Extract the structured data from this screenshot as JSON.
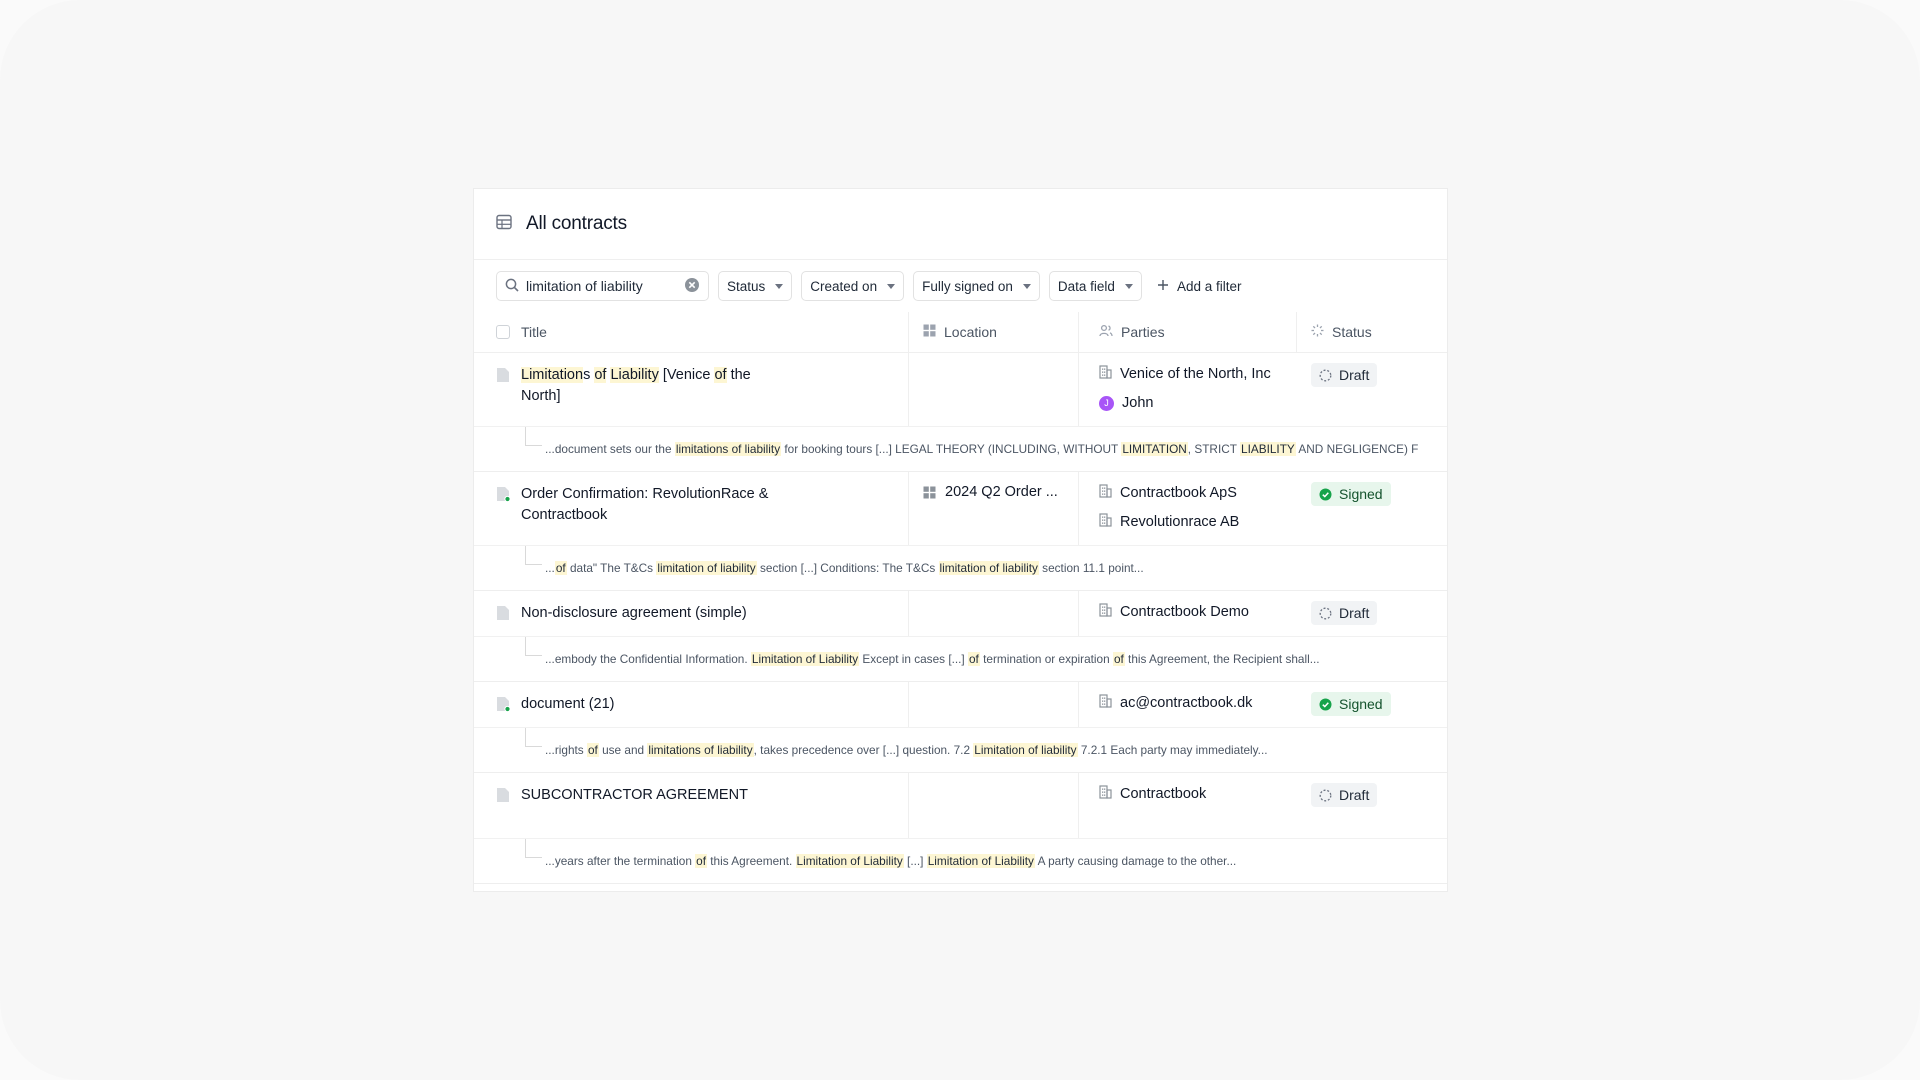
{
  "header": {
    "title": "All contracts",
    "icon": "table-icon"
  },
  "toolbar": {
    "search_value": "limitation of liability",
    "filters": [
      "Status",
      "Created on",
      "Fully signed on",
      "Data field"
    ],
    "add_filter_label": "Add a filter"
  },
  "columns": {
    "title": "Title",
    "location": "Location",
    "parties": "Parties",
    "status": "Status"
  },
  "rows": [
    {
      "title_parts": [
        [
          "Limitation",
          true
        ],
        [
          "s ",
          false
        ],
        [
          "of",
          true
        ],
        [
          " ",
          false
        ],
        [
          "Liability",
          true
        ],
        [
          " [Venice ",
          false
        ],
        [
          "of",
          true
        ],
        [
          " the North]",
          false
        ]
      ],
      "location": "",
      "parties": [
        {
          "name": "Venice of the North, Inc",
          "icon": "building-icon"
        },
        {
          "name": "John",
          "icon": "avatar",
          "initial": "J"
        }
      ],
      "status": "Draft",
      "signed_dot": false,
      "snippet_parts": [
        [
          "...document sets our the ",
          false
        ],
        [
          "limitations of liability",
          true
        ],
        [
          " for booking tours [...] LEGAL THEORY (INCLUDING, WITHOUT ",
          false
        ],
        [
          "LIMITATION",
          true
        ],
        [
          ", STRICT ",
          false
        ],
        [
          "LIABILITY",
          true
        ],
        [
          " AND NEGLIGENCE) F",
          false
        ]
      ]
    },
    {
      "title_parts": [
        [
          "Order Confirmation: RevolutionRace & Contractbook",
          false
        ]
      ],
      "location": "2024 Q2 Order ...",
      "parties": [
        {
          "name": "Contractbook ApS",
          "icon": "building-icon"
        },
        {
          "name": "Revolutionrace AB",
          "icon": "building-icon"
        }
      ],
      "status": "Signed",
      "signed_dot": true,
      "snippet_parts": [
        [
          "...",
          false
        ],
        [
          "of",
          true
        ],
        [
          " data\" The T&Cs ",
          false
        ],
        [
          "limitation of liability",
          true
        ],
        [
          " section [...] Conditions: The T&Cs ",
          false
        ],
        [
          "limitation of liability",
          true
        ],
        [
          " section 11.1 point...",
          false
        ]
      ]
    },
    {
      "title_parts": [
        [
          "Non-disclosure agreement (simple)",
          false
        ]
      ],
      "location": "",
      "parties": [
        {
          "name": "Contractbook Demo",
          "icon": "building-icon"
        }
      ],
      "status": "Draft",
      "signed_dot": false,
      "snippet_parts": [
        [
          "...embody the Confidential Information. ",
          false
        ],
        [
          "Limitation of Liability",
          true
        ],
        [
          " Except in cases [...] ",
          false
        ],
        [
          "of",
          true
        ],
        [
          " termination or expiration ",
          false
        ],
        [
          "of",
          true
        ],
        [
          " this Agreement, the Recipient shall...",
          false
        ]
      ]
    },
    {
      "title_parts": [
        [
          "document (21)",
          false
        ]
      ],
      "location": "",
      "parties": [
        {
          "name": "ac@contractbook.dk",
          "icon": "building-icon"
        }
      ],
      "status": "Signed",
      "signed_dot": true,
      "snippet_parts": [
        [
          "...rights ",
          false
        ],
        [
          "of",
          true
        ],
        [
          " use and ",
          false
        ],
        [
          "limitations of liability",
          true
        ],
        [
          ", takes precedence over [...] question. 7.2 ",
          false
        ],
        [
          "Limitation of liability",
          true
        ],
        [
          " 7.2.1 Each party may immediately...",
          false
        ]
      ]
    },
    {
      "title_parts": [
        [
          "SUBCONTRACTOR AGREEMENT",
          false
        ]
      ],
      "location": "",
      "parties": [
        {
          "name": "Contractbook",
          "icon": "building-icon"
        }
      ],
      "status": "Draft",
      "signed_dot": false,
      "snippet_parts": [
        [
          "...years after the termination ",
          false
        ],
        [
          "of",
          true
        ],
        [
          " this Agreement. ",
          false
        ],
        [
          "Limitation of Liability",
          true
        ],
        [
          " [...] ",
          false
        ],
        [
          "Limitation of Liability",
          true
        ],
        [
          " A party causing damage to the other...",
          false
        ]
      ]
    }
  ],
  "colors": {
    "signed_bg": "#e7f6ec",
    "signed_icon": "#16a34a",
    "draft_bg": "#f1f3f5",
    "highlight": "#fdf6d3",
    "avatar": "#a855f7"
  }
}
